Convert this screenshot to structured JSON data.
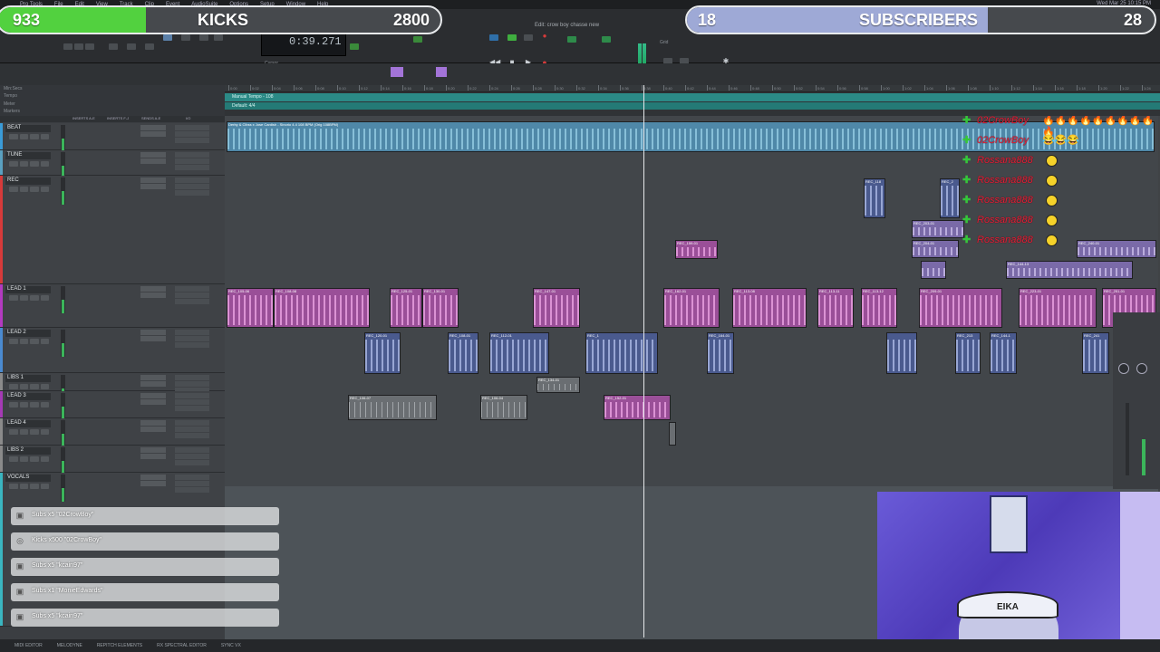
{
  "menubar": {
    "items": [
      "Pro Tools",
      "File",
      "Edit",
      "View",
      "Track",
      "Clip",
      "Event",
      "AudioSuite",
      "Options",
      "Setup",
      "Window",
      "Help"
    ],
    "clock": "Wed Mar 25 10:15 PM"
  },
  "overlay": {
    "kicks": {
      "count": "933",
      "label": "KICKS",
      "goal": "2800",
      "progress": 0.333,
      "color": "#52d13f"
    },
    "subs": {
      "count": "18",
      "label": "SUBSCRIBERS",
      "goal": "28",
      "progress": 0.643,
      "color": "#9ea9d6"
    }
  },
  "transport": {
    "counter": "0:39.271",
    "window_title": "Edit: crow boy chasse new",
    "cursor_label": "Cursor",
    "grid_label": "Grid",
    "nudge_label": "Nudge"
  },
  "rulers": {
    "labels": [
      "Min:Secs",
      "Tempo",
      "Meter",
      "Markers"
    ],
    "tempo": "Manual Tempo - 108",
    "meter": "Default: 4/4",
    "ticks": [
      "0:00",
      "0:02",
      "0:04",
      "0:06",
      "0:08",
      "0:10",
      "0:12",
      "0:14",
      "0:16",
      "0:18",
      "0:20",
      "0:22",
      "0:24",
      "0:26",
      "0:28",
      "0:30",
      "0:32",
      "0:34",
      "0:36",
      "0:38",
      "0:40",
      "0:42",
      "0:44",
      "0:46",
      "0:48",
      "0:50",
      "0:52",
      "0:54",
      "0:56",
      "0:58",
      "1:00",
      "1:02",
      "1:04",
      "1:06",
      "1:08",
      "1:10",
      "1:12",
      "1:14",
      "1:16",
      "1:18",
      "1:20",
      "1:22",
      "1:24"
    ]
  },
  "column_headers": [
    "INSERTS A-E",
    "INSERTS F-J",
    "SENDS A-E",
    "I/O"
  ],
  "tracks": [
    {
      "name": "BEAT",
      "color": "#3a9bd8"
    },
    {
      "name": "TUNE",
      "color": "#5aa0c0"
    },
    {
      "name": "REC",
      "color": "#d63a3a"
    },
    {
      "name": "LEAD 1",
      "color": "#b33ac0"
    },
    {
      "name": "LEAD 2",
      "color": "#4a8ad0"
    },
    {
      "name": "LIBS 1",
      "color": "#8a8a8a"
    },
    {
      "name": "LEAD 3",
      "color": "#a53ab5"
    },
    {
      "name": "LEAD 4",
      "color": "#8a8a8a"
    },
    {
      "name": "LIBS 2",
      "color": "#8a8a8a"
    },
    {
      "name": "VOCALS",
      "color": "#3ab5c0"
    }
  ],
  "beat_clip": {
    "title": "Derby & Clbss x Jose Cardish - Sinorio 4.4 108 BPM (Orig 108BPM)"
  },
  "chat": [
    {
      "name": "02CrowBoy",
      "msg": "🔥🔥🔥🔥🔥🔥🔥🔥🔥🔥"
    },
    {
      "name": "02CrowBoy",
      "msg": "😂😂😂"
    },
    {
      "name": "Rossana888",
      "msg": ""
    },
    {
      "name": "Rossana888",
      "msg": ""
    },
    {
      "name": "Rossana888",
      "msg": ""
    },
    {
      "name": "Rossana888",
      "msg": ""
    },
    {
      "name": "Rossana888",
      "msg": ""
    }
  ],
  "alerts": [
    {
      "text": "Subs x5 \"02CrowBoy\""
    },
    {
      "text": "Kicks x500 \"02CrowBoy\""
    },
    {
      "text": "Subs x5 \"kcain97\""
    },
    {
      "text": "Subs x1 \"MonieEdwards\""
    },
    {
      "text": "Subs x5 \"kcain97\""
    }
  ],
  "webcam": {
    "cap_text": "EIKA"
  },
  "bottom_bar": [
    "MIDI EDITOR",
    "MELODYNE",
    "REPITCH ELEMENTS",
    "RX SPECTRAL EDITOR",
    "SYNC VX"
  ],
  "clips": {
    "rec_1": "REC_118",
    "rec_2": "REC_2",
    "rec_3": "REC_159-01",
    "rec_4": "REC_203-01",
    "rec_5": "REC_204-01",
    "rec_6": "REC_240-01",
    "rec_7": "REC_144-13",
    "lead1_1": "REC_105-06",
    "lead1_2": "REC_108-08",
    "lead1_3": "REC_125-01",
    "lead1_4": "REC_130-01",
    "lead1_5": "REC_147-01",
    "lead1_6": "REC_162-01",
    "lead1_7": "REC_113-08",
    "lead1_8": "REC_113-11",
    "lead1_9": "REC_113-12",
    "lead1_10": "REC_209-01",
    "lead1_11": "REC_223-01",
    "lead1_12": "REC_251-01",
    "lead2_1": "REC_120-01",
    "lead2_2": "REC_108-01",
    "lead2_3": "REC_112-01",
    "lead2_4": "REC_1",
    "lead2_5": "REC_164-01",
    "lead2_6": "REC_213",
    "lead2_7": "REC_144-1",
    "lead2_8": "REC_241",
    "libs1_1": "REC_134-01",
    "lead3_1": "REC_106-07",
    "lead3_2": "REC_106-04",
    "lead3_3": "REC_152-01"
  }
}
